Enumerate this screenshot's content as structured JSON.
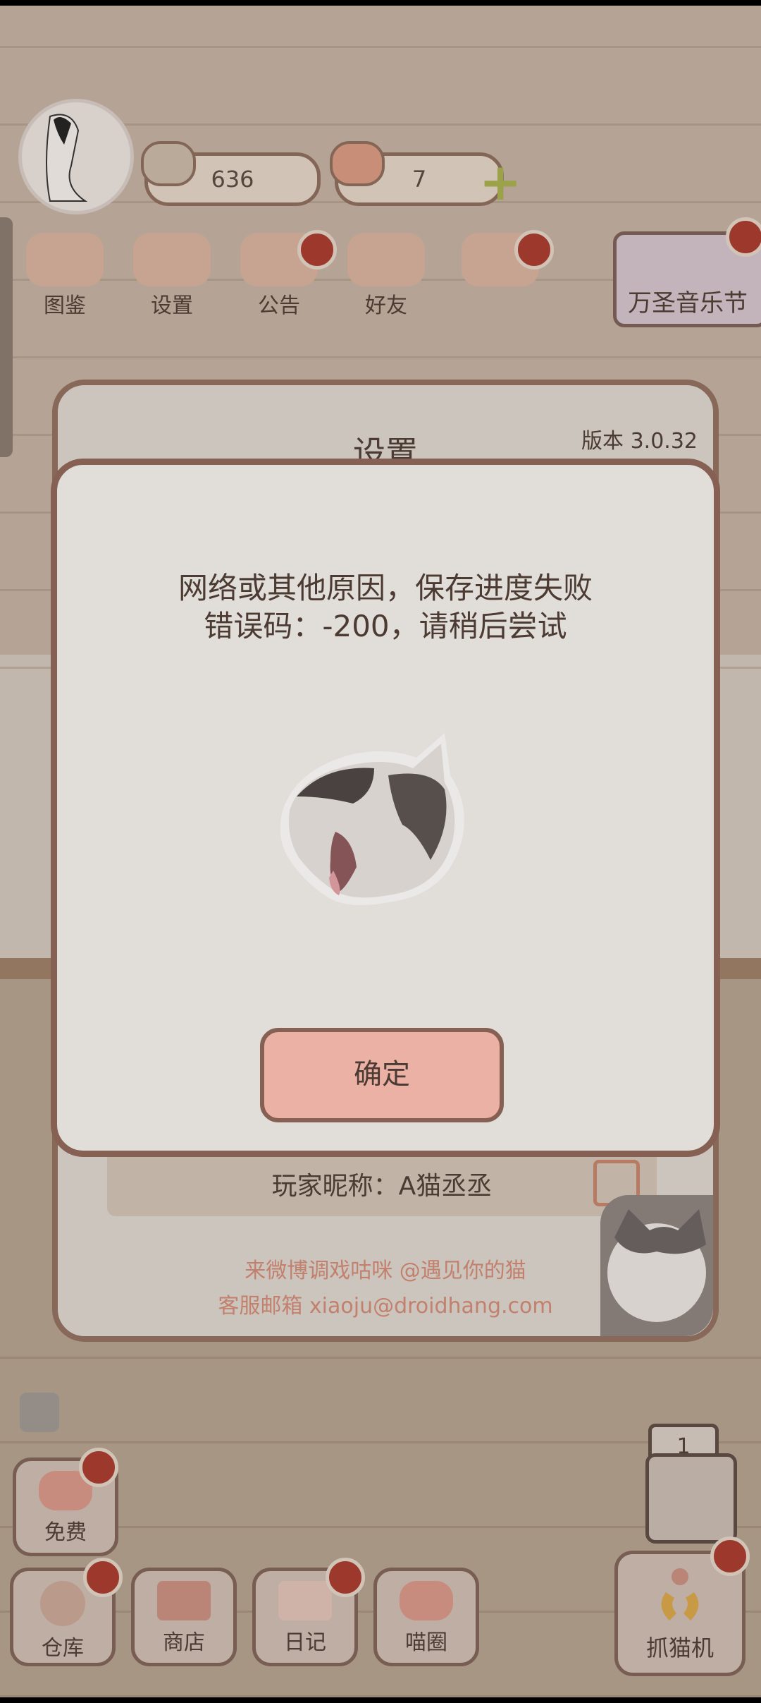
{
  "hud": {
    "fish_count": "636",
    "heart_count": "7",
    "plus_icon": "plus-icon"
  },
  "menu": {
    "items": [
      {
        "label": "图鉴",
        "icon": "cat-face-icon",
        "badge": false
      },
      {
        "label": "设置",
        "icon": "gear-icon",
        "badge": false
      },
      {
        "label": "公告",
        "icon": "gift-icon",
        "badge": true
      },
      {
        "label": "好友",
        "icon": "friends-icon",
        "badge": false
      },
      {
        "label": "",
        "icon": "heart-mail-icon",
        "badge": true
      }
    ],
    "event_label": "万圣音乐节"
  },
  "settings": {
    "title": "设置",
    "version": "版本 3.0.32",
    "nickname": "玩家昵称：A猫丞丞",
    "weibo_text": "来微博调戏咕咪 @遇见你的猫",
    "email_text": "客服邮箱 xiaoju@droidhang.com"
  },
  "dialog": {
    "line1": "网络或其他原因，保存进度失败",
    "line2": "错误码：-200，请稍后尝试",
    "confirm": "确定"
  },
  "bottom": {
    "free": "免费",
    "warehouse": "仓库",
    "shop": "商店",
    "diary": "日记",
    "circle": "喵圈",
    "claw_machine": "抓猫机",
    "machine_count": "1"
  },
  "colors": {
    "dialog_border": "#8f6759",
    "confirm_button": "#ffc1b4",
    "badge_red": "#a83b2e",
    "link_text": "#d28b77"
  }
}
